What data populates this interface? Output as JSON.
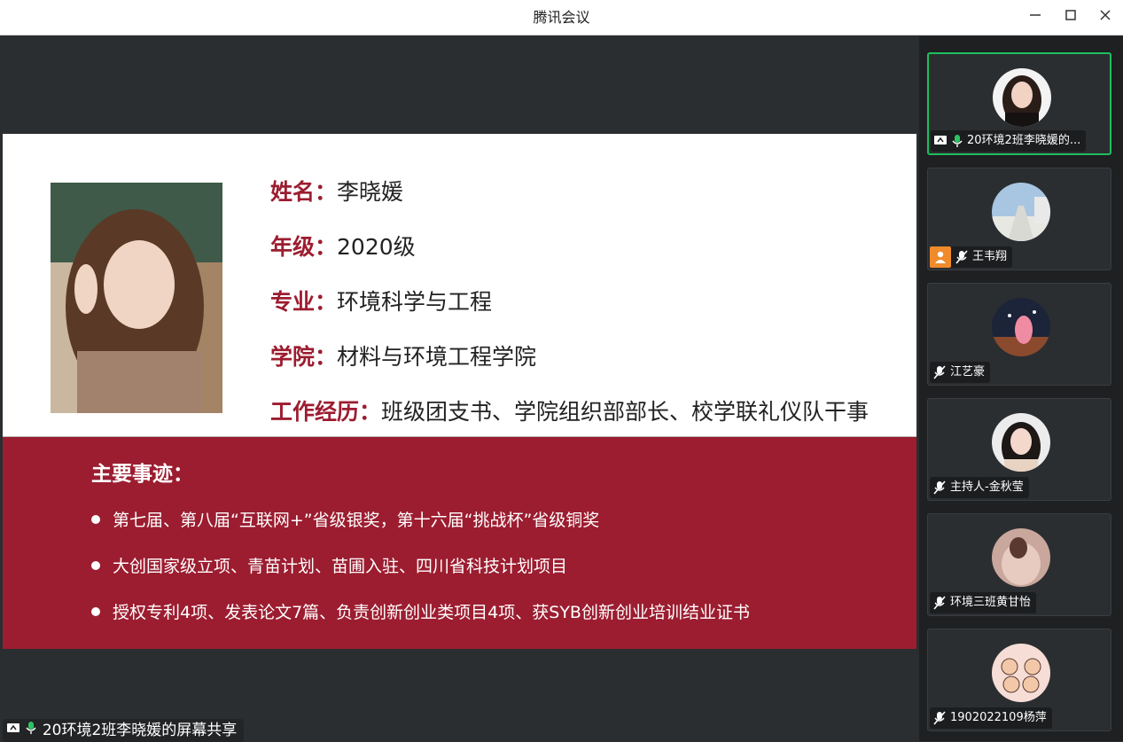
{
  "window": {
    "title": "腾讯会议"
  },
  "slide": {
    "profile": [
      {
        "label": "姓名：",
        "value": "李晓媛"
      },
      {
        "label": "年级：",
        "value": "2020级"
      },
      {
        "label": "专业：",
        "value": "环境科学与工程"
      },
      {
        "label": "学院：",
        "value": "材料与环境工程学院"
      },
      {
        "label": "工作经历：",
        "value": "班级团支书、学院组织部部长、校学联礼仪队干事"
      }
    ],
    "achievements_title": "主要事迹：",
    "achievements": [
      "第七届、第八届“互联网+”省级银奖，第十六届“挑战杯”省级铜奖",
      "大创国家级立项、青苗计划、苗圃入驻、四川省科技计划项目",
      "授权专利4项、发表论文7篇、负责创新创业类项目4项、获SYB创新创业培训结业证书"
    ],
    "colors": {
      "accent": "#9c1d30"
    }
  },
  "share_label": "20环境2班李晓媛的屏幕共享",
  "participants": [
    {
      "name": "20环境2班李晓媛的...",
      "sharing": true,
      "mic": "on",
      "active": true
    },
    {
      "name": "王韦翔",
      "has_user_badge": true,
      "mic": "muted"
    },
    {
      "name": "江艺豪",
      "mic": "muted"
    },
    {
      "name": "主持人-金秋莹",
      "mic": "muted"
    },
    {
      "name": "环境三班黄甘怡",
      "mic": "muted"
    },
    {
      "name": "1902022109杨萍",
      "mic": "muted"
    }
  ]
}
